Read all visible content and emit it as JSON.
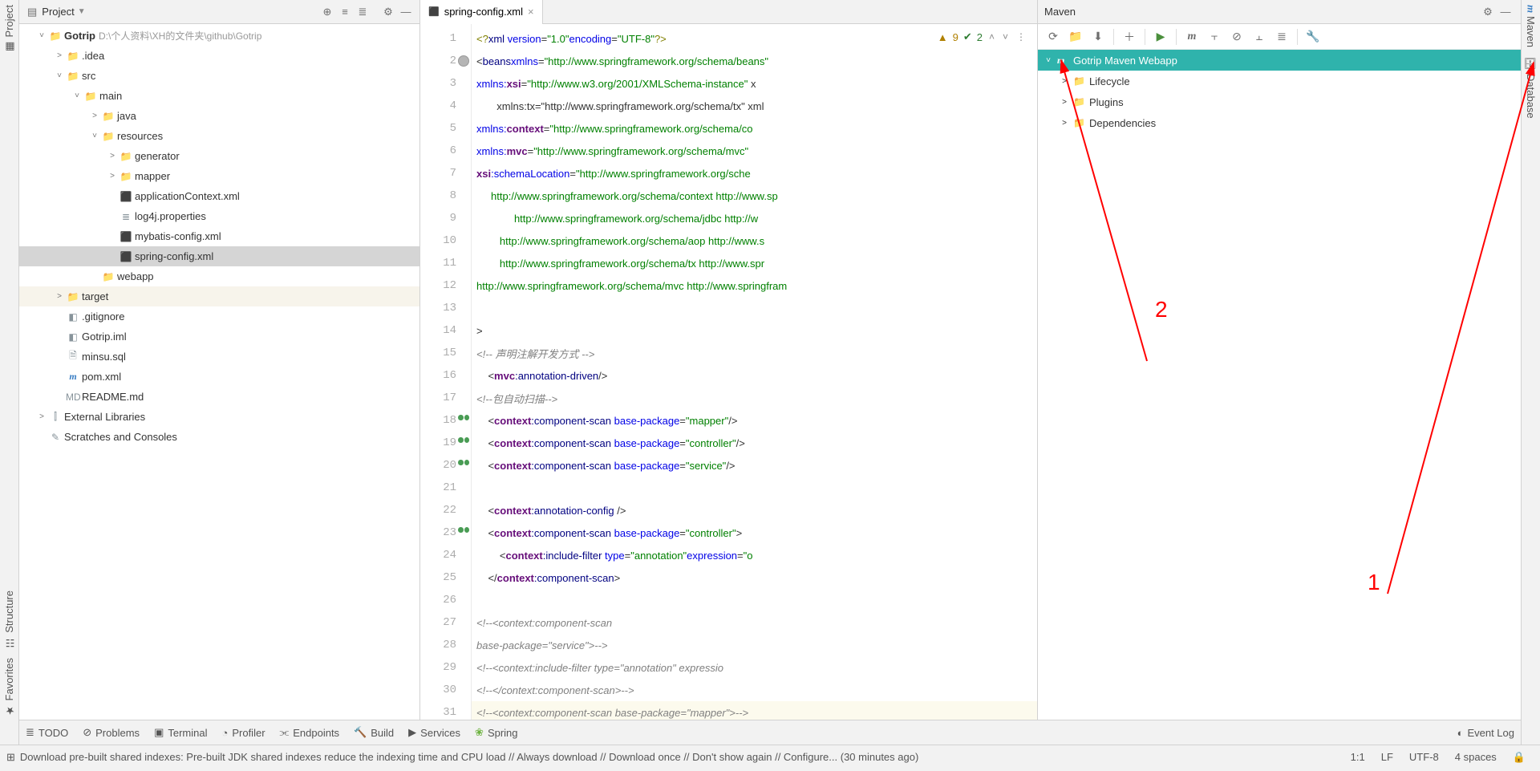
{
  "left_strip": {
    "project": "Project",
    "structure": "Structure",
    "favorites": "Favorites"
  },
  "right_strip": {
    "maven": "Maven",
    "database": "Database"
  },
  "project_panel": {
    "title": "Project",
    "tree": [
      {
        "indent": 0,
        "arrow": "v",
        "icon": "📁",
        "label": "Gotrip",
        "path": "D:\\个人资料\\XH的文件夹\\github\\Gotrip",
        "bold": true
      },
      {
        "indent": 1,
        "arrow": ">",
        "icon": "📁",
        "label": ".idea"
      },
      {
        "indent": 1,
        "arrow": "v",
        "icon": "📁",
        "label": "src"
      },
      {
        "indent": 2,
        "arrow": "v",
        "icon": "📁",
        "label": "main"
      },
      {
        "indent": 3,
        "arrow": ">",
        "icon": "📁",
        "iconClass": "blue",
        "label": "java"
      },
      {
        "indent": 3,
        "arrow": "v",
        "icon": "📁",
        "label": "resources"
      },
      {
        "indent": 4,
        "arrow": ">",
        "icon": "📁",
        "label": "generator"
      },
      {
        "indent": 4,
        "arrow": ">",
        "icon": "📁",
        "label": "mapper"
      },
      {
        "indent": 4,
        "arrow": "",
        "icon": "xml",
        "label": "applicationContext.xml"
      },
      {
        "indent": 4,
        "arrow": "",
        "icon": "prop",
        "label": "log4j.properties"
      },
      {
        "indent": 4,
        "arrow": "",
        "icon": "xml",
        "label": "mybatis-config.xml"
      },
      {
        "indent": 4,
        "arrow": "",
        "icon": "xml",
        "label": "spring-config.xml",
        "selected": true
      },
      {
        "indent": 3,
        "arrow": "",
        "icon": "📁",
        "iconClass": "blue",
        "label": "webapp"
      },
      {
        "indent": 1,
        "arrow": ">",
        "icon": "📁",
        "iconClass": "red",
        "label": "target",
        "dim": true
      },
      {
        "indent": 1,
        "arrow": "",
        "icon": "file",
        "label": ".gitignore"
      },
      {
        "indent": 1,
        "arrow": "",
        "icon": "file",
        "label": "Gotrip.iml"
      },
      {
        "indent": 1,
        "arrow": "",
        "icon": "sql",
        "label": "minsu.sql"
      },
      {
        "indent": 1,
        "arrow": "",
        "icon": "m",
        "label": "pom.xml"
      },
      {
        "indent": 1,
        "arrow": "",
        "icon": "md",
        "label": "README.md"
      },
      {
        "indent": 0,
        "arrow": ">",
        "icon": "lib",
        "label": "External Libraries"
      },
      {
        "indent": 0,
        "arrow": "",
        "icon": "scratch",
        "label": "Scratches and Consoles"
      }
    ]
  },
  "editor": {
    "tab": "spring-config.xml",
    "inspections": {
      "warnings": "9",
      "checks": "2"
    },
    "lines": [
      {
        "n": 1,
        "html": "<span class='t-pi'>&lt;?</span><span class='t-tag'>xml </span><span class='t-attr'>version</span>=<span class='t-str'>\"1.0\"</span> <span class='t-attr'>encoding</span>=<span class='t-str'>\"UTF-8\"</span><span class='t-pi'>?&gt;</span>"
      },
      {
        "n": 2,
        "mark": "grey",
        "html": "&lt;<span class='t-tag'>beans</span>  <span class='t-attr'>xmlns</span>=<span class='t-str'>\"http://www.springframework.org/schema/beans\"</span>"
      },
      {
        "n": 3,
        "html": "       <span class='t-attr'>xmlns:</span><span class='t-ns'>xsi</span>=<span class='t-str'>\"http://www.w3.org/2001/XMLSchema-instance\"</span> x"
      },
      {
        "n": 4,
        "html": "       xmlns:tx=\"http://www.springframework.org/schema/tx\" xml"
      },
      {
        "n": 5,
        "html": "       <span class='t-attr'>xmlns:</span><span class='t-ns'>context</span>=<span class='t-str'>\"http://www.springframework.org/schema/co</span>"
      },
      {
        "n": 6,
        "html": "       <span class='t-attr'>xmlns:</span><span class='t-ns'>mvc</span>=<span class='t-str'>\"http://www.springframework.org/schema/mvc\"</span>"
      },
      {
        "n": 7,
        "html": "       <span class='t-ns'>xsi</span><span class='t-attr'>:schemaLocation</span>=<span class='t-str'>\"http://www.springframework.org/sche</span>"
      },
      {
        "n": 8,
        "html": "<span class='t-str'>     http://www.springframework.org/schema/context http://www.sp</span>"
      },
      {
        "n": 9,
        "html": "<span class='t-str'>             http://www.springframework.org/schema/jdbc http://w</span>"
      },
      {
        "n": 10,
        "html": "<span class='t-str'>        http://www.springframework.org/schema/aop http://www.s</span>"
      },
      {
        "n": 11,
        "html": "<span class='t-str'>        http://www.springframework.org/schema/tx http://www.spr</span>"
      },
      {
        "n": 12,
        "html": "<span class='t-str'>http://www.springframework.org/schema/mvc http://www.springfram</span>"
      },
      {
        "n": 13,
        "html": ""
      },
      {
        "n": 14,
        "html": "&gt;"
      },
      {
        "n": 15,
        "html": "    <span class='t-comm'>&lt;!-- 声明注解开发方式 --&gt;</span>"
      },
      {
        "n": 16,
        "html": "    &lt;<span class='t-ns'>mvc</span><span class='t-tag'>:annotation-driven</span>/&gt;"
      },
      {
        "n": 17,
        "html": "    <span class='t-comm'>&lt;!--包自动扫描--&gt;</span>"
      },
      {
        "n": 18,
        "mark": "pair",
        "html": "    &lt;<span class='t-ns'>context</span><span class='t-tag'>:component-scan </span><span class='t-attr'>base-package</span>=<span class='t-str'>\"mapper\"</span>/&gt;"
      },
      {
        "n": 19,
        "mark": "pair",
        "html": "    &lt;<span class='t-ns'>context</span><span class='t-tag'>:component-scan </span><span class='t-attr'>base-package</span>=<span class='t-str'>\"controller\"</span>/&gt;"
      },
      {
        "n": 20,
        "mark": "pair",
        "html": "    &lt;<span class='t-ns'>context</span><span class='t-tag'>:component-scan </span><span class='t-attr'>base-package</span>=<span class='t-str'>\"service\"</span>/&gt;"
      },
      {
        "n": 21,
        "html": ""
      },
      {
        "n": 22,
        "html": "    &lt;<span class='t-ns'>context</span><span class='t-tag'>:annotation-config </span>/&gt;"
      },
      {
        "n": 23,
        "mark": "pair",
        "html": "    &lt;<span class='t-ns'>context</span><span class='t-tag'>:component-scan </span><span class='t-attr'>base-package</span>=<span class='t-str'>\"controller\"</span>&gt;"
      },
      {
        "n": 24,
        "html": "        &lt;<span class='t-ns'>context</span><span class='t-tag'>:include-filter </span><span class='t-attr'>type</span>=<span class='t-str'>\"annotation\"</span> <span class='t-attr'>expression</span>=<span class='t-str'>\"o</span>"
      },
      {
        "n": 25,
        "html": "    &lt;/<span class='t-ns'>context</span><span class='t-tag'>:component-scan</span>&gt;"
      },
      {
        "n": 26,
        "html": ""
      },
      {
        "n": 27,
        "html": "    <span class='t-comm'>&lt;!--&lt;context:component-scan</span>"
      },
      {
        "n": 28,
        "html": "    <span class='t-comm'>base-package=\"service\"&gt;--&gt;</span>"
      },
      {
        "n": 29,
        "html": "        <span class='t-comm'>&lt;!--&lt;context:include-filter type=\"annotation\" expressio</span>"
      },
      {
        "n": 30,
        "html": "    <span class='t-comm'>&lt;!--&lt;/context:component-scan&gt;--&gt;</span>"
      },
      {
        "n": 31,
        "current": true,
        "html": "    <span class='t-comm'>&lt;!--&lt;context:component-scan base-package=\"mapper\"&gt;--&gt;</span>"
      }
    ]
  },
  "maven": {
    "title": "Maven",
    "project": "Gotrip Maven Webapp",
    "items": [
      "Lifecycle",
      "Plugins",
      "Dependencies"
    ]
  },
  "bottom_tools": {
    "items": [
      "TODO",
      "Problems",
      "Terminal",
      "Profiler",
      "Endpoints",
      "Build",
      "Services",
      "Spring"
    ],
    "event_log": "Event Log"
  },
  "status": {
    "message": "Download pre-built shared indexes: Pre-built JDK shared indexes reduce the indexing time and CPU load // Always download // Download once // Don't show again // Configure... (30 minutes ago)",
    "caret": "1:1",
    "line_sep": "LF",
    "encoding": "UTF-8",
    "indent": "4 spaces"
  },
  "annotations": {
    "n1": "1",
    "n2": "2"
  }
}
